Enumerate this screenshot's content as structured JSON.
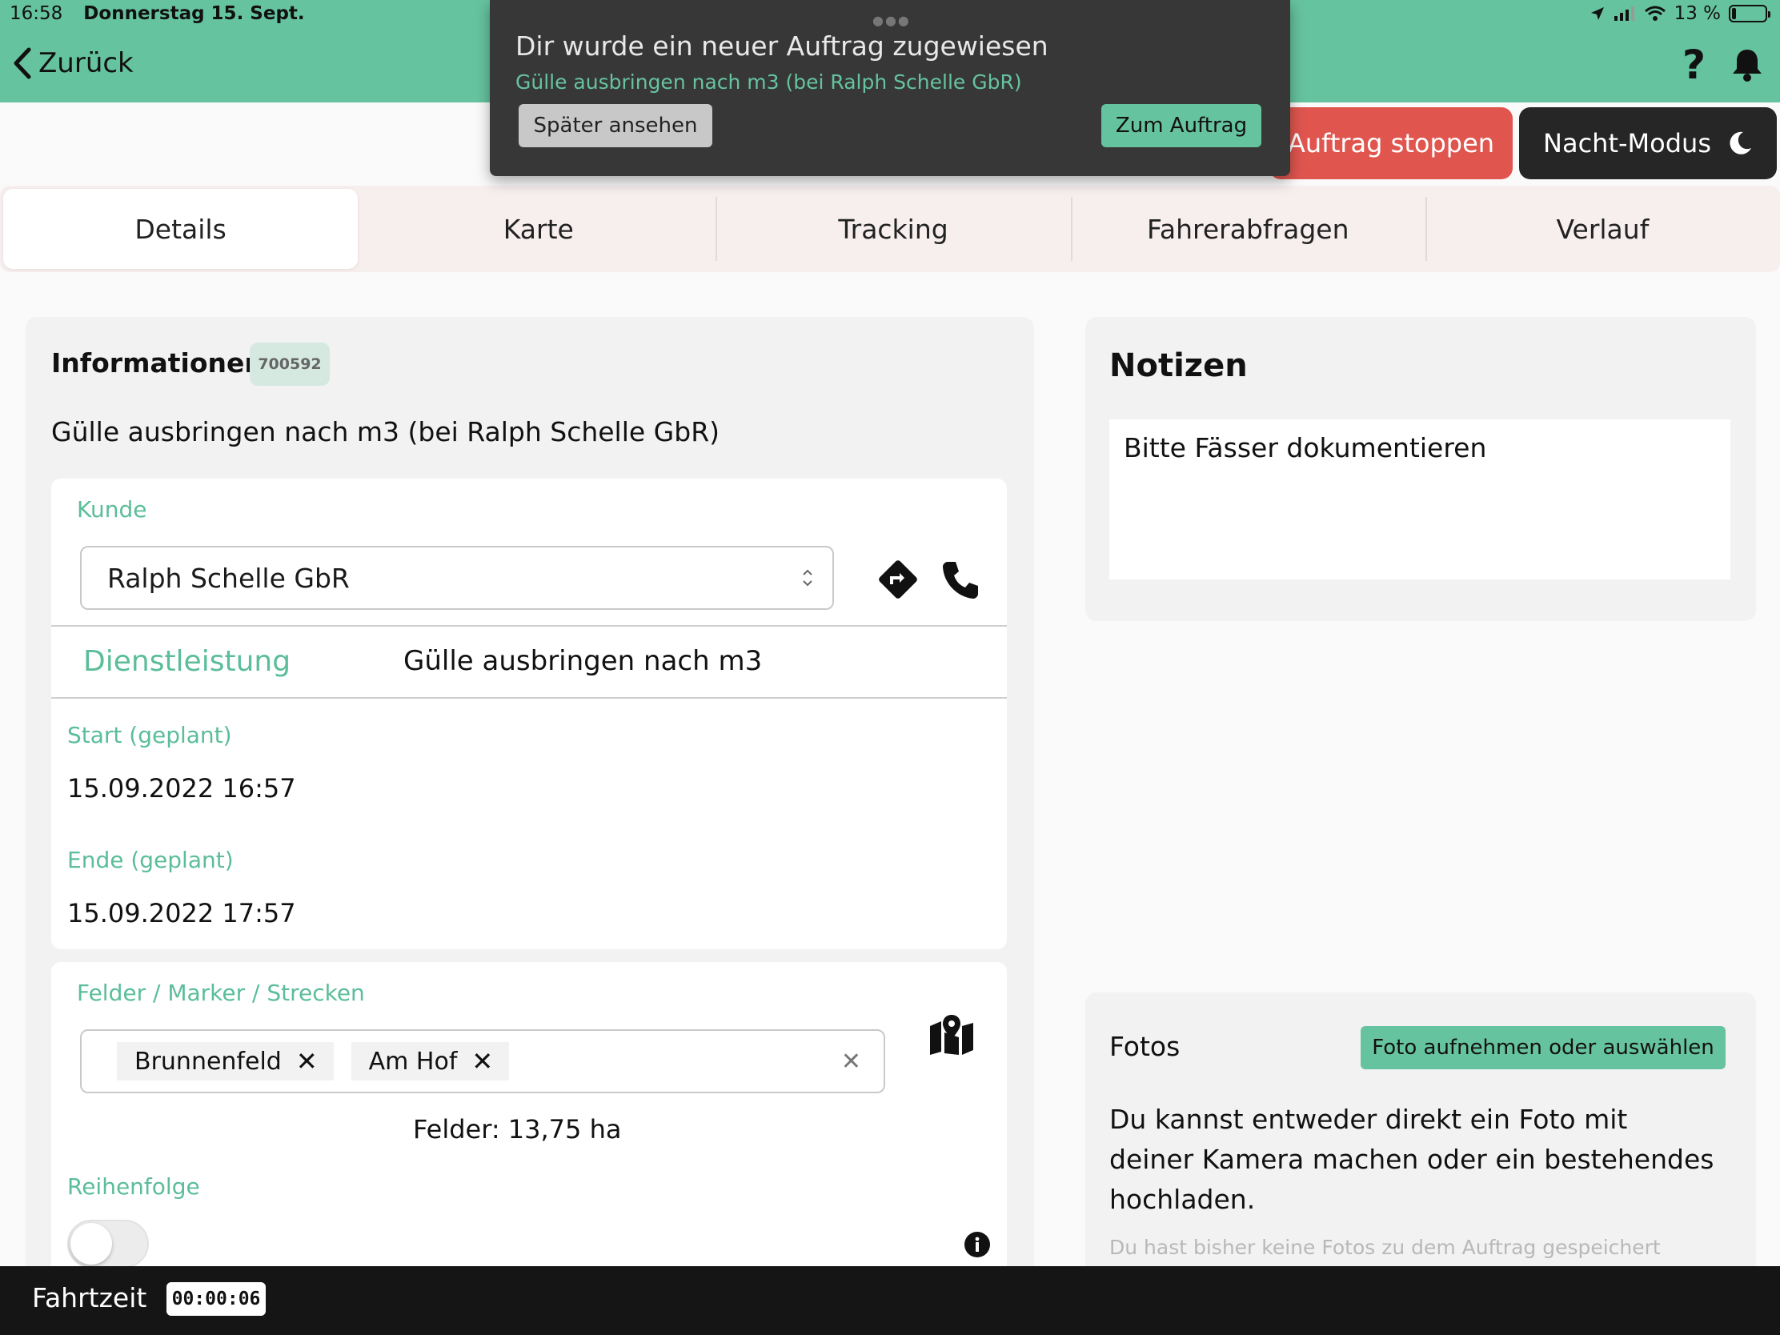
{
  "status": {
    "time": "16:58",
    "date": "Donnerstag 15. Sept.",
    "battery": "13 %"
  },
  "header": {
    "back_label": "Zurück",
    "help_label": "?"
  },
  "actions": {
    "stop_label": "Auftrag stoppen",
    "night_label": "Nacht-Modus"
  },
  "tabs": [
    {
      "label": "Details",
      "active": true
    },
    {
      "label": "Karte",
      "active": false
    },
    {
      "label": "Tracking",
      "active": false
    },
    {
      "label": "Fahrerabfragen",
      "active": false
    },
    {
      "label": "Verlauf",
      "active": false
    }
  ],
  "info": {
    "title": "Informationen",
    "order_number": "700592",
    "subtitle": "Gülle ausbringen nach m3 (bei Ralph Schelle GbR)"
  },
  "kunde": {
    "label": "Kunde",
    "value": "Ralph Schelle GbR"
  },
  "dienstleistung": {
    "label": "Dienstleistung",
    "value": "Gülle ausbringen nach m3"
  },
  "schedule": {
    "start_label": "Start (geplant)",
    "start_value": "15.09.2022 16:57",
    "end_label": "Ende (geplant)",
    "end_value": "15.09.2022 17:57"
  },
  "felder": {
    "label": "Felder / Marker / Strecken",
    "tags": [
      "Brunnenfeld",
      "Am Hof"
    ],
    "summary": "Felder: 13,75 ha",
    "order_label": "Reihenfolge"
  },
  "notes": {
    "title": "Notizen",
    "text": "Bitte Fässer dokumentieren"
  },
  "fotos": {
    "title": "Fotos",
    "button_label": "Foto aufnehmen oder auswählen",
    "description": "Du kannst entweder direkt ein Foto mit deiner Kamera machen oder ein bestehendes hochladen.",
    "empty_text": "Du hast bisher keine Fotos zu dem Auftrag gespeichert"
  },
  "footer": {
    "drive_label": "Fahrtzeit",
    "drive_time": "00:00:06"
  },
  "toast": {
    "title": "Dir wurde ein neuer Auftrag zugewiesen",
    "subtitle": "Gülle ausbringen nach m3 (bei Ralph Schelle GbR)",
    "later_label": "Später ansehen",
    "go_label": "Zum Auftrag"
  },
  "colors": {
    "brand_green": "#66c3a0",
    "stop_red": "#e0564f",
    "dark": "#262626"
  }
}
